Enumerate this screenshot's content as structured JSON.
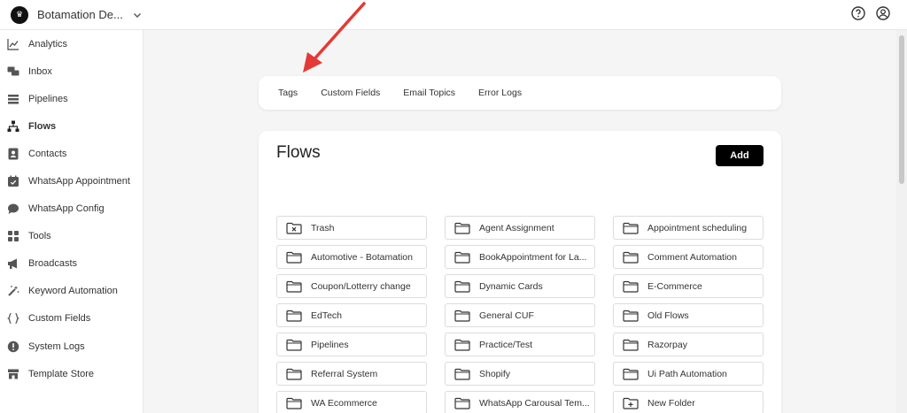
{
  "header": {
    "workspace_name": "Botamation De...",
    "icons": [
      "help-icon",
      "account-icon"
    ]
  },
  "sidebar": {
    "items": [
      {
        "label": "Analytics",
        "icon": "chart-icon"
      },
      {
        "label": "Inbox",
        "icon": "chat-icon"
      },
      {
        "label": "Pipelines",
        "icon": "pipeline-icon"
      },
      {
        "label": "Flows",
        "icon": "flows-icon"
      },
      {
        "label": "Contacts",
        "icon": "contact-icon"
      },
      {
        "label": "WhatsApp Appointment",
        "icon": "calendar-icon"
      },
      {
        "label": "WhatsApp Config",
        "icon": "speech-bubble-icon"
      },
      {
        "label": "Tools",
        "icon": "tools-grid-icon"
      },
      {
        "label": "Broadcasts",
        "icon": "megaphone-icon"
      },
      {
        "label": "Keyword Automation",
        "icon": "magic-wand-icon"
      },
      {
        "label": "Custom Fields",
        "icon": "braces-icon"
      },
      {
        "label": "System Logs",
        "icon": "alert-icon"
      },
      {
        "label": "Template Store",
        "icon": "store-icon"
      }
    ]
  },
  "tabs": [
    "Tags",
    "Custom Fields",
    "Email Topics",
    "Error Logs"
  ],
  "flows": {
    "title": "Flows",
    "add_label": "Add",
    "folders": [
      {
        "label": "Trash",
        "icon": "trash-folder-icon"
      },
      {
        "label": "Agent Assignment",
        "icon": "folder-icon"
      },
      {
        "label": "Appointment scheduling",
        "icon": "folder-icon"
      },
      {
        "label": "Automotive - Botamation",
        "icon": "folder-icon"
      },
      {
        "label": "BookAppointment for La...",
        "icon": "folder-icon"
      },
      {
        "label": "Comment Automation",
        "icon": "folder-icon"
      },
      {
        "label": "Coupon/Lotterry change",
        "icon": "folder-icon"
      },
      {
        "label": "Dynamic Cards",
        "icon": "folder-icon"
      },
      {
        "label": "E-Commerce",
        "icon": "folder-icon"
      },
      {
        "label": "EdTech",
        "icon": "folder-icon"
      },
      {
        "label": "General CUF",
        "icon": "folder-icon"
      },
      {
        "label": "Old Flows",
        "icon": "folder-icon"
      },
      {
        "label": "Pipelines",
        "icon": "folder-icon"
      },
      {
        "label": "Practice/Test",
        "icon": "folder-icon"
      },
      {
        "label": "Razorpay",
        "icon": "folder-icon"
      },
      {
        "label": "Referral System",
        "icon": "folder-icon"
      },
      {
        "label": "Shopify",
        "icon": "folder-icon"
      },
      {
        "label": "Ui Path Automation",
        "icon": "folder-icon"
      },
      {
        "label": "WA Ecommerce",
        "icon": "folder-icon"
      },
      {
        "label": "WhatsApp Carousal Tem...",
        "icon": "folder-icon"
      },
      {
        "label": "New Folder",
        "icon": "new-folder-icon"
      }
    ]
  },
  "colors": {
    "annotation_arrow": "#e53935",
    "primary_button": "#000000"
  }
}
